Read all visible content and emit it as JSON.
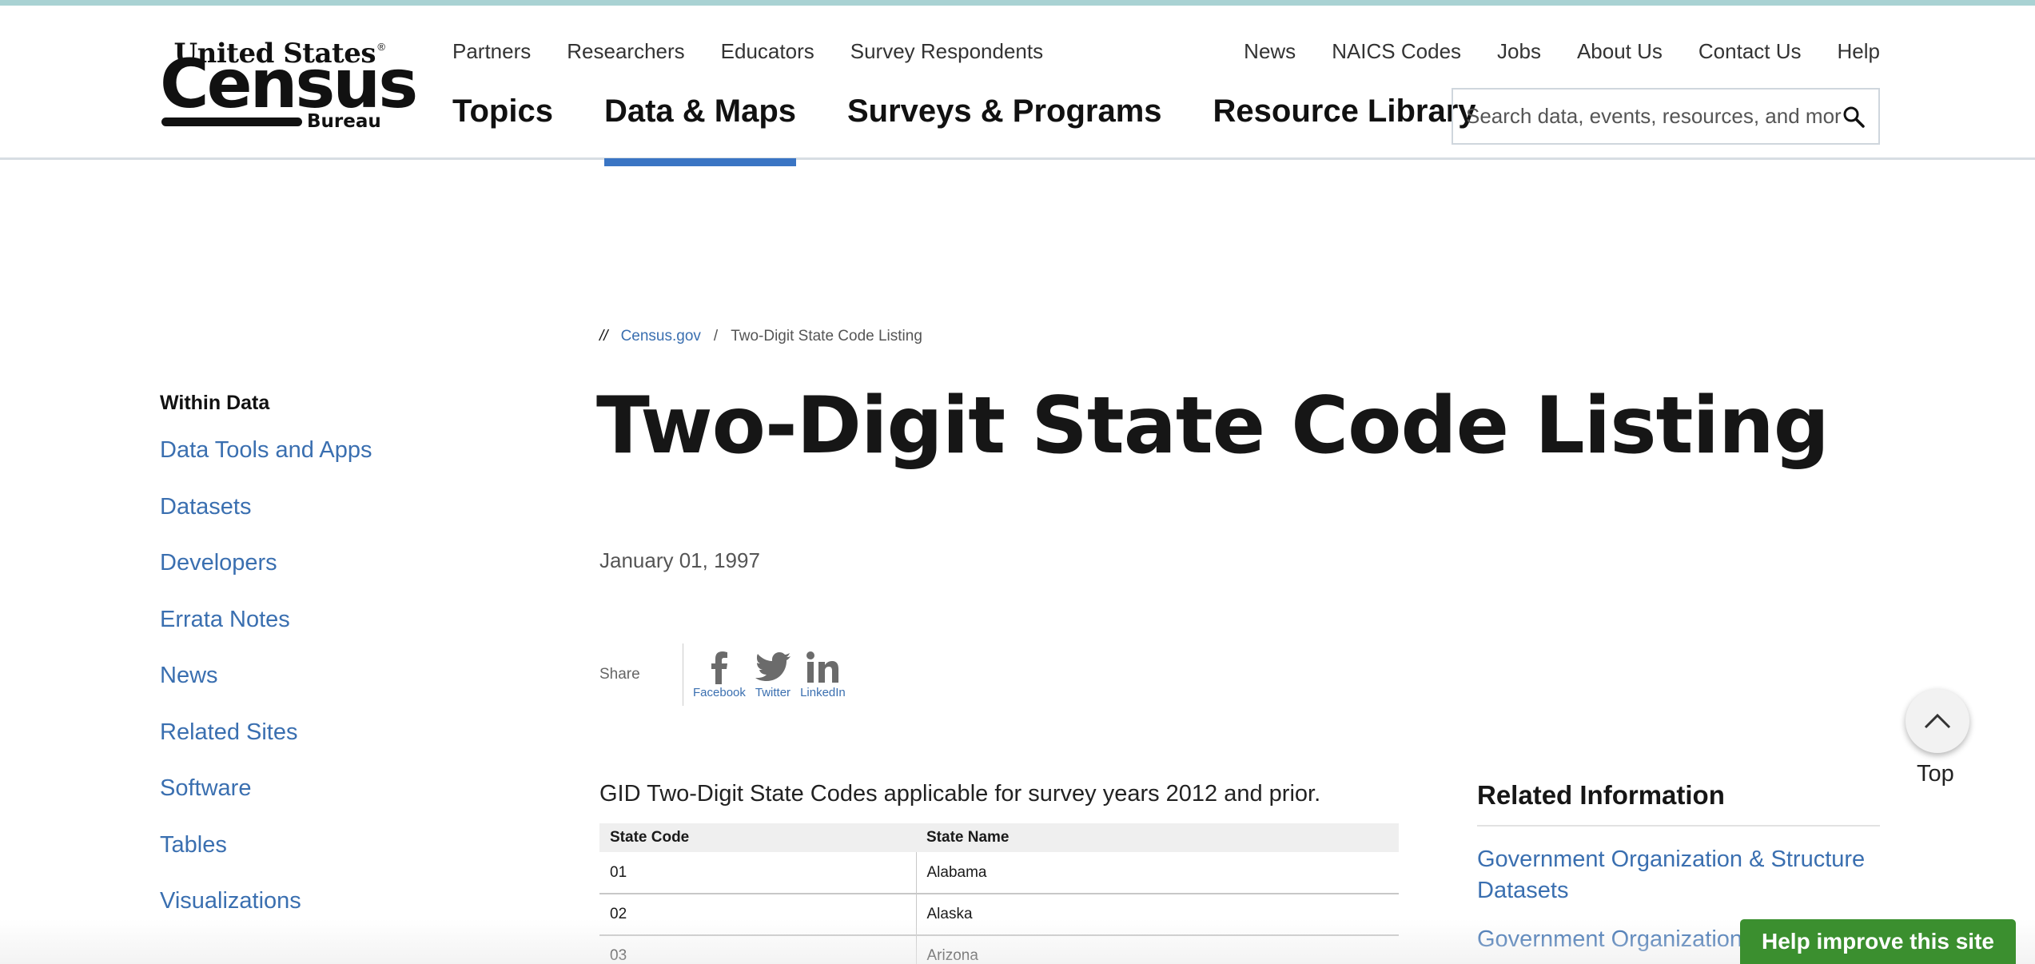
{
  "logo": {
    "line1": "United States",
    "reg": "®",
    "line2": "Census",
    "line3": "Bureau"
  },
  "utility_nav_left": [
    "Partners",
    "Researchers",
    "Educators",
    "Survey Respondents"
  ],
  "utility_nav_right": [
    "News",
    "NAICS Codes",
    "Jobs",
    "About Us",
    "Contact Us",
    "Help"
  ],
  "main_nav": [
    {
      "label": "Topics",
      "active": false
    },
    {
      "label": "Data & Maps",
      "active": true
    },
    {
      "label": "Surveys & Programs",
      "active": false
    },
    {
      "label": "Resource Library",
      "active": false
    }
  ],
  "search": {
    "placeholder": "Search data, events, resources, and more",
    "icon": "search-icon"
  },
  "sidebar": {
    "heading": "Within Data",
    "items": [
      "Data Tools and Apps",
      "Datasets",
      "Developers",
      "Errata Notes",
      "News",
      "Related Sites",
      "Software",
      "Tables",
      "Visualizations"
    ]
  },
  "breadcrumb": {
    "lead": "//",
    "home": "Census.gov",
    "separator": "/",
    "current": "Two-Digit State Code Listing"
  },
  "page": {
    "title": "Two-Digit State Code Listing",
    "date": "January 01, 1997",
    "intro": "GID Two-Digit State Codes applicable for survey years 2012 and prior."
  },
  "share": {
    "label": "Share",
    "networks": [
      {
        "label": "Facebook",
        "icon": "facebook-icon"
      },
      {
        "label": "Twitter",
        "icon": "twitter-icon"
      },
      {
        "label": "LinkedIn",
        "icon": "linkedin-icon"
      }
    ]
  },
  "table": {
    "headers": [
      "State Code",
      "State Name"
    ],
    "rows": [
      [
        "01",
        "Alabama"
      ],
      [
        "02",
        "Alaska"
      ],
      [
        "03",
        "Arizona"
      ]
    ]
  },
  "related": {
    "title": "Related Information",
    "links": [
      "Government Organization & Structure Datasets",
      "Government Organization"
    ]
  },
  "top_button": {
    "label": "Top",
    "icon": "chevron-up-icon"
  },
  "help_button": {
    "label": "Help improve this site"
  },
  "colors": {
    "link": "#3a6fb0",
    "accent": "#3a75c4",
    "help_green": "#3b8f2f"
  }
}
